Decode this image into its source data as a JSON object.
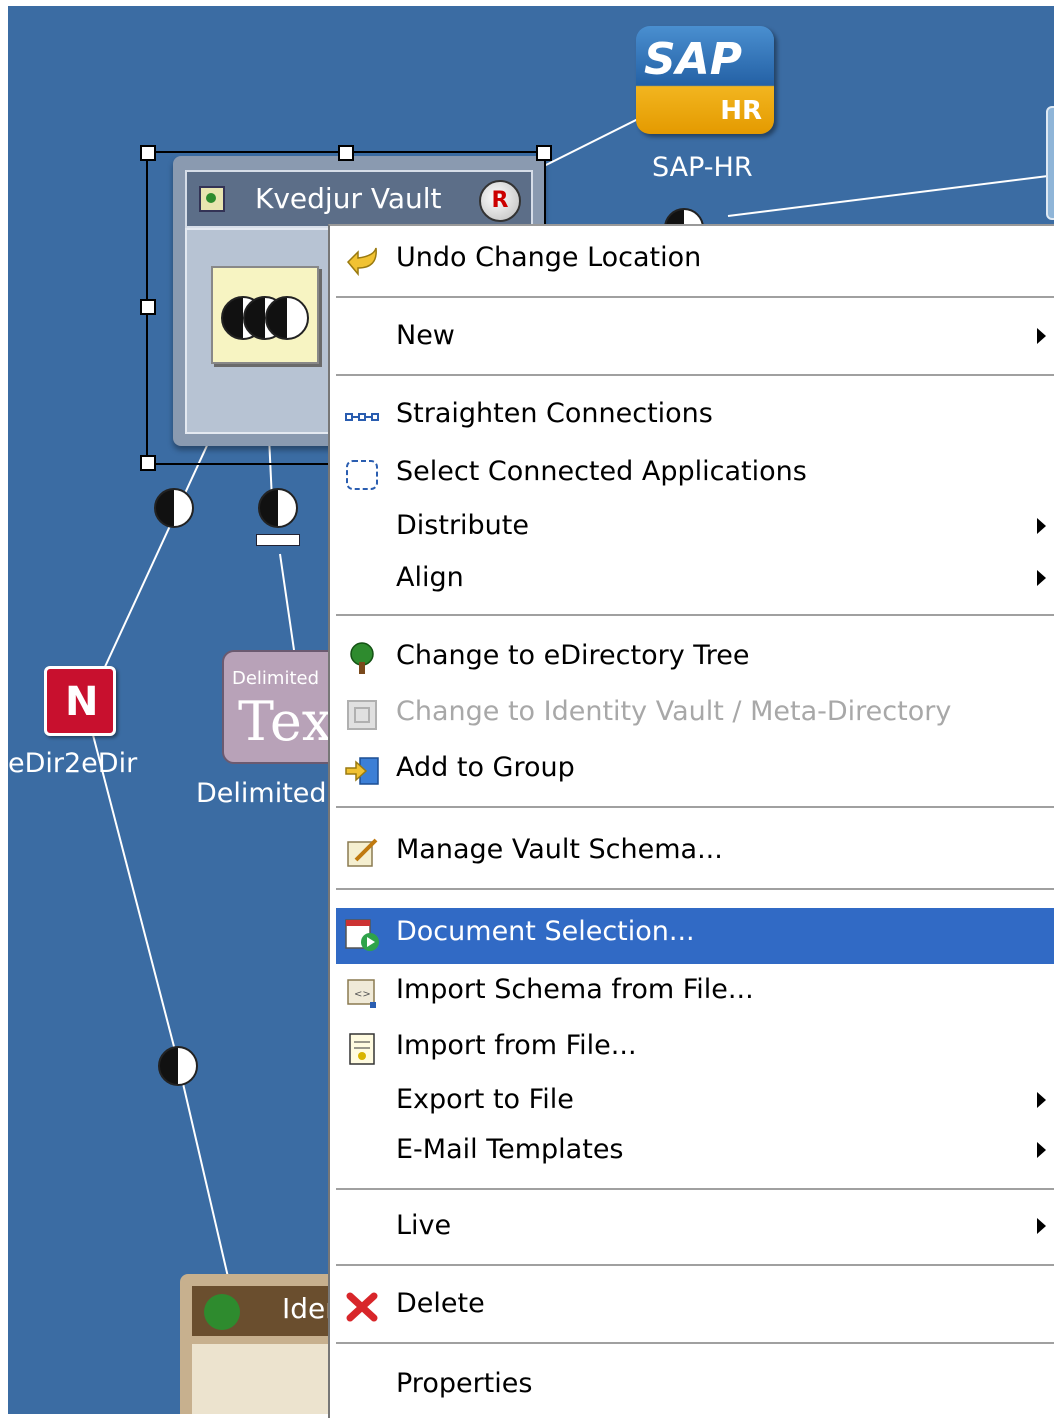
{
  "canvas": {
    "nodes": {
      "vault_title": "Kvedjur Vault",
      "vault_badge": "R",
      "sap_logo": "SAP",
      "sap_logo_sub": "HR",
      "sap_label": "SAP-HR",
      "edir_label": "eDir2eDir",
      "delimited_label": "Delimited",
      "delimited_icon_small": "Delimited",
      "delimited_icon_big": "Tex",
      "identity_label": "Ider"
    }
  },
  "menu": {
    "items": [
      {
        "label": "Undo Change Location",
        "icon": "undo-arrow-icon",
        "submenu": false,
        "enabled": true
      },
      {
        "label": "New",
        "icon": "",
        "submenu": true,
        "enabled": true
      },
      {
        "label": "Straighten Connections",
        "icon": "connections-icon",
        "submenu": false,
        "enabled": true
      },
      {
        "label": "Select Connected Applications",
        "icon": "dashed-selection-icon",
        "submenu": false,
        "enabled": true
      },
      {
        "label": "Distribute",
        "icon": "",
        "submenu": true,
        "enabled": true
      },
      {
        "label": "Align",
        "icon": "",
        "submenu": true,
        "enabled": true
      },
      {
        "label": "Change to eDirectory Tree",
        "icon": "tree-icon",
        "submenu": false,
        "enabled": true
      },
      {
        "label": "Change to Identity Vault / Meta-Directory",
        "icon": "vault-icon",
        "submenu": false,
        "enabled": false
      },
      {
        "label": "Add to Group",
        "icon": "add-group-icon",
        "submenu": false,
        "enabled": true
      },
      {
        "label": "Manage Vault Schema...",
        "icon": "schema-scroll-icon",
        "submenu": false,
        "enabled": true
      },
      {
        "label": "Document Selection...",
        "icon": "document-play-icon",
        "submenu": false,
        "enabled": true,
        "highlighted": true
      },
      {
        "label": "Import Schema from File...",
        "icon": "import-schema-icon",
        "submenu": false,
        "enabled": true
      },
      {
        "label": "Import from File...",
        "icon": "import-file-icon",
        "submenu": false,
        "enabled": true
      },
      {
        "label": "Export to File",
        "icon": "",
        "submenu": true,
        "enabled": true
      },
      {
        "label": "E-Mail Templates",
        "icon": "",
        "submenu": true,
        "enabled": true
      },
      {
        "label": "Live",
        "icon": "",
        "submenu": true,
        "enabled": true
      },
      {
        "label": "Delete",
        "icon": "delete-x-icon",
        "submenu": false,
        "enabled": true
      },
      {
        "label": "Properties",
        "icon": "",
        "submenu": false,
        "enabled": true
      }
    ]
  },
  "colors": {
    "canvas_bg": "#3b6ca3",
    "highlight": "#316ac5",
    "disabled_text": "#a8a8a8"
  }
}
